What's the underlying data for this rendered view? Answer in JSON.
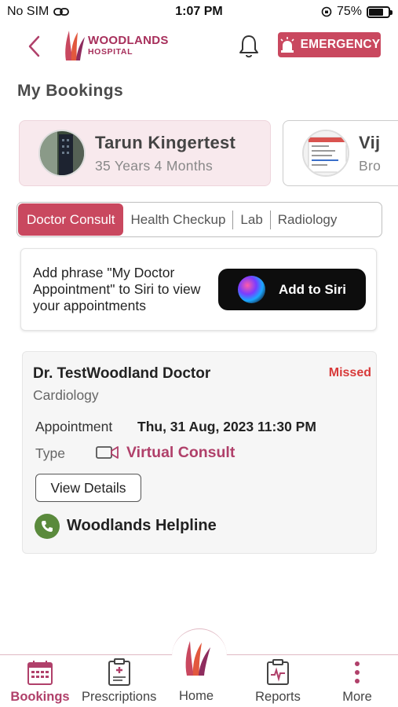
{
  "status_bar": {
    "carrier": "No SIM",
    "time": "1:07 PM",
    "battery": "75%",
    "battery_level": 0.75
  },
  "header": {
    "logo_line1": "WOODLANDS",
    "logo_line2": "HOSPITAL",
    "emergency_label": "EMERGENCY"
  },
  "page_title": "My Bookings",
  "patients": [
    {
      "name": "Tarun Kingertest",
      "age": "35 Years 4 Months"
    },
    {
      "name": "Vij",
      "age": "Bro"
    }
  ],
  "tabs": [
    {
      "label": "Doctor Consult"
    },
    {
      "label": "Health Checkup"
    },
    {
      "label": "Lab"
    },
    {
      "label": "Radiology"
    }
  ],
  "siri": {
    "text": "Add phrase \"My Doctor Appointment\" to Siri to view your appointments",
    "button_label": "Add to Siri"
  },
  "appointment": {
    "doctor": "Dr. TestWoodland Doctor",
    "status": "Missed",
    "department": "Cardiology",
    "appointment_label": "Appointment",
    "appointment_value": "Thu, 31 Aug, 2023 11:30 PM",
    "type_label": "Type",
    "type_value": "Virtual Consult",
    "view_details": "View Details",
    "helpline": "Woodlands Helpline"
  },
  "bottom_nav": {
    "bookings": "Bookings",
    "prescriptions": "Prescriptions",
    "home": "Home",
    "reports": "Reports",
    "more": "More"
  },
  "colors": {
    "brand": "#c9485f",
    "brand_dark": "#a72f5b",
    "missed": "#d83a3a",
    "helpline_green": "#5a8a3c"
  }
}
